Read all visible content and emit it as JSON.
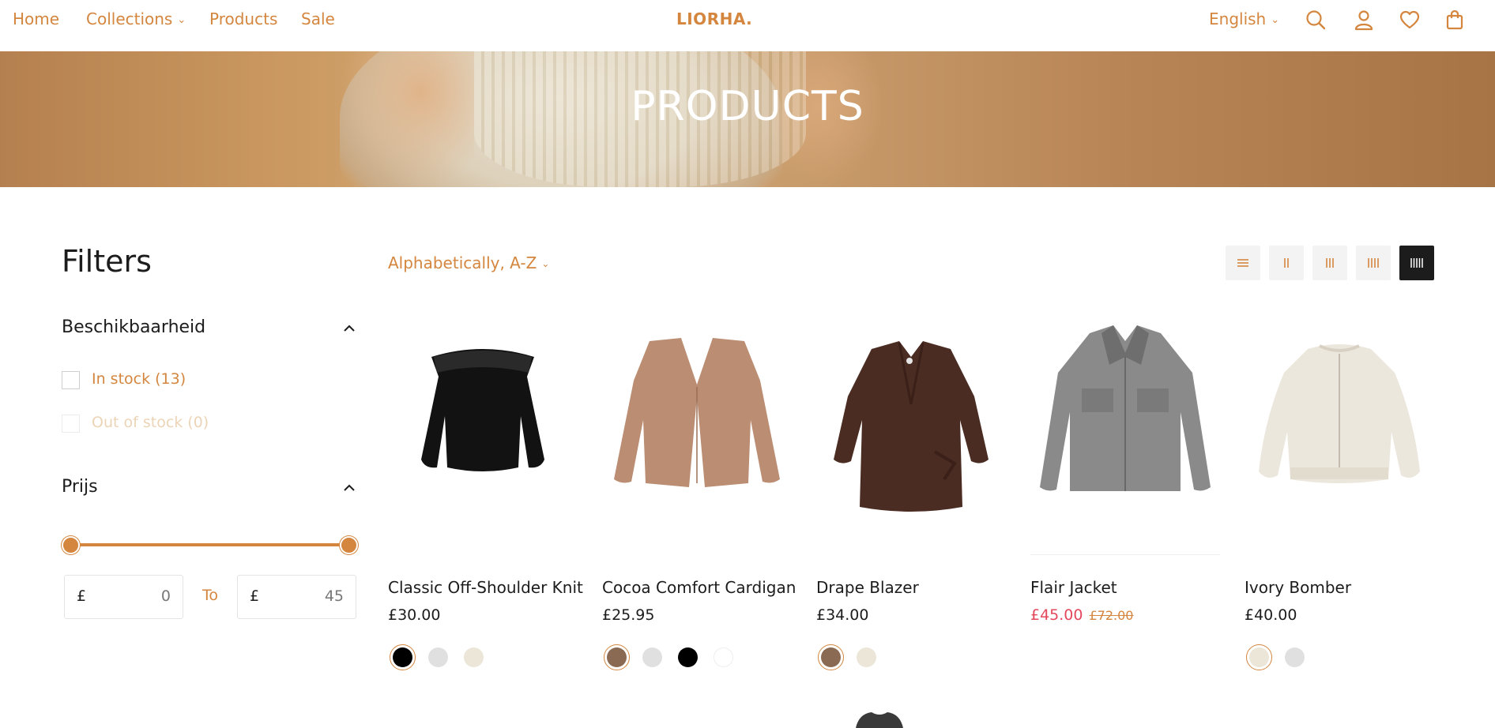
{
  "header": {
    "nav": [
      {
        "label": "Home"
      },
      {
        "label": "Collections"
      },
      {
        "label": "Products"
      },
      {
        "label": "Sale"
      }
    ],
    "logo": "LIORHA.",
    "language": "English",
    "icons": [
      "search-icon",
      "account-icon",
      "wishlist-heart-icon",
      "cart-bag-icon"
    ]
  },
  "hero": {
    "title": "PRODUCTS"
  },
  "filters": {
    "title": "Filters",
    "availability": {
      "title": "Beschikbaarheid",
      "options": [
        {
          "label": "In stock (13)",
          "enabled": true
        },
        {
          "label": "Out of stock (0)",
          "enabled": false
        }
      ]
    },
    "price": {
      "title": "Prijs",
      "currency": "£",
      "min": "0",
      "max": "45",
      "to_label": "To",
      "range_fraction": [
        0,
        1
      ]
    }
  },
  "toolbar": {
    "sort_label": "Alphabetically, A-Z",
    "view_options": [
      "list-view-icon",
      "grid-2-icon",
      "grid-3-icon",
      "grid-4-icon",
      "grid-5-icon"
    ],
    "active_view": "grid-5-icon"
  },
  "products": [
    {
      "name": "Classic Off-Shoulder Knit",
      "price": "£30.00",
      "swatches": [
        "#000000",
        "#e0e0e0",
        "#ece6d8"
      ]
    },
    {
      "name": "Cocoa Comfort Cardigan",
      "price": "£25.95",
      "swatches": [
        "#8a6a52",
        "#e0e0e0",
        "#000000",
        "#ffffff"
      ]
    },
    {
      "name": "Drape Blazer",
      "price": "£34.00",
      "swatches": [
        "#8a6a52",
        "#ece6d8"
      ]
    },
    {
      "name": "Flair Jacket",
      "price": "£45.00",
      "compare_price": "£72.00",
      "swatches": []
    },
    {
      "name": "Ivory Bomber",
      "price": "£40.00",
      "swatches": [
        "#ece6d8",
        "#e0e0e0"
      ]
    }
  ],
  "colors": {
    "accent": "#d4863f",
    "sale": "#e3485c",
    "text": "#1c1c1c"
  }
}
